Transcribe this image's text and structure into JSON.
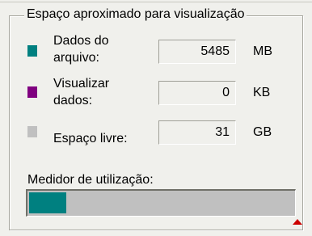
{
  "group": {
    "title": "Espaço aproximado para visualização"
  },
  "rows": [
    {
      "label_line1": "Dados do",
      "label_line2": "arquivo:",
      "value": "5485",
      "unit": "MB",
      "color": "#008080"
    },
    {
      "label_line1": "Visualizar",
      "label_line2": "dados:",
      "value": "0",
      "unit": "KB",
      "color": "#800080"
    },
    {
      "label": "Espaço livre:",
      "value": "31",
      "unit": "GB",
      "color": "#c0c0c0"
    }
  ],
  "meter": {
    "label": "Medidor de utilização:",
    "used_fraction": 0.14,
    "used_color": "#008080",
    "free_color": "#c0c0c0",
    "marker_color": "#cc0000"
  }
}
